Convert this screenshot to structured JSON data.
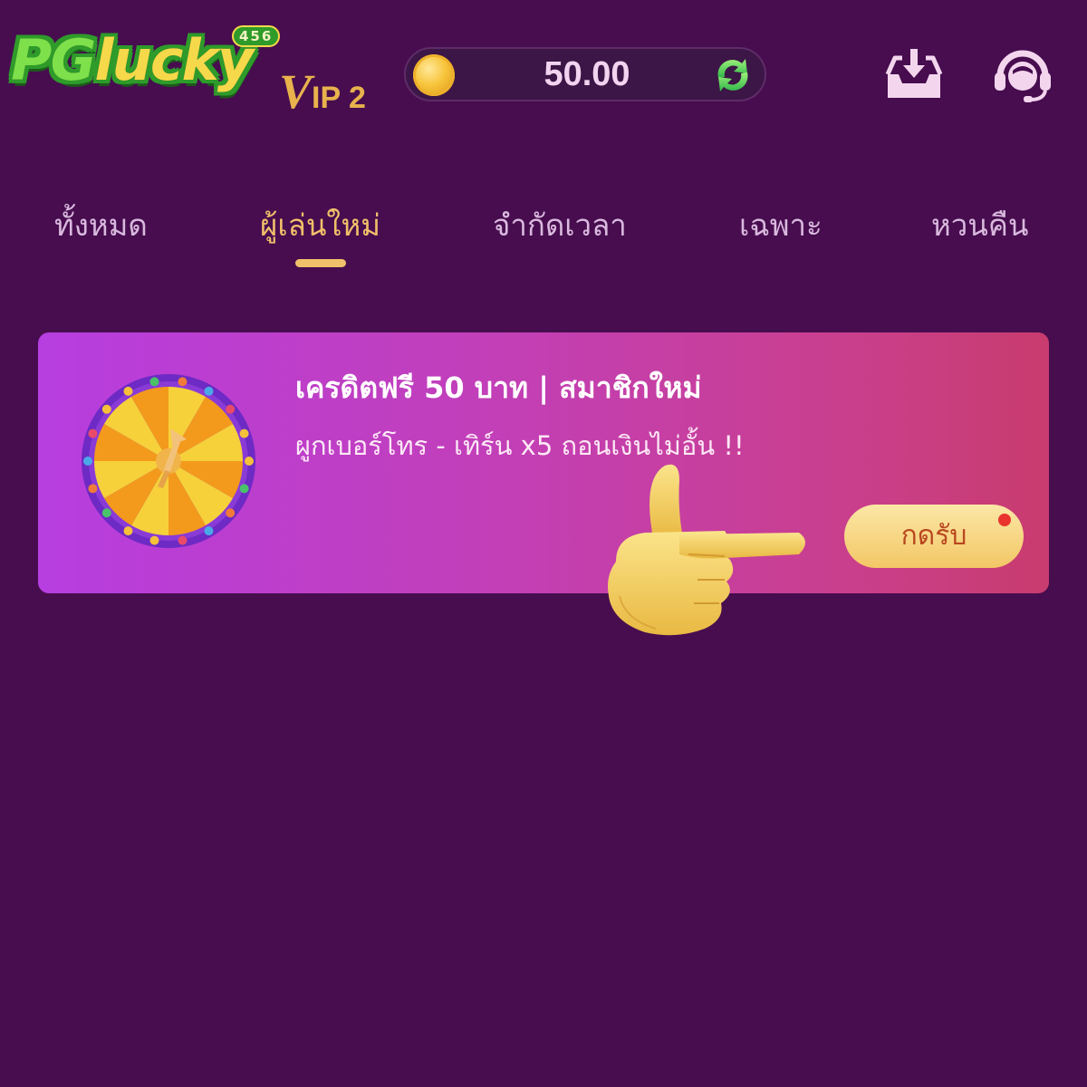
{
  "header": {
    "logo": {
      "brand": "PGlucky",
      "badge": "456"
    },
    "vip": {
      "v": "V",
      "rest": "IP 2"
    },
    "balance": {
      "value": "50.00",
      "icon": "gold-coin-icon",
      "refresh_icon": "refresh-icon"
    },
    "actions": [
      {
        "name": "download",
        "icon": "download-tray-icon"
      },
      {
        "name": "support",
        "icon": "headset-support-icon"
      }
    ]
  },
  "tabs": [
    {
      "label": "ทั้งหมด",
      "active": false
    },
    {
      "label": "ผู้เล่นใหม่",
      "active": true
    },
    {
      "label": "จำกัดเวลา",
      "active": false
    },
    {
      "label": "เฉพาะ",
      "active": false
    },
    {
      "label": "หวนคืน",
      "active": false
    }
  ],
  "promo": {
    "title": "เครดิตฟรี 50 บาท | สมาชิกใหม่",
    "subtitle": "ผูกเบอร์โทร - เทิร์น x5 ถอนเงินไม่อั้น !!",
    "button_label": "กดรับ",
    "image": "prize-wheel-icon",
    "has_notification": true
  },
  "overlay": {
    "icon": "pointing-hand-icon"
  },
  "colors": {
    "background": "#470d4f",
    "tab_active": "#f1c06a",
    "tab_inactive": "#d9b9de",
    "card_gradient_start": "#b73ee0",
    "card_gradient_end": "#c83c6e",
    "button": "#f3c766",
    "notification_dot": "#e8342d"
  }
}
